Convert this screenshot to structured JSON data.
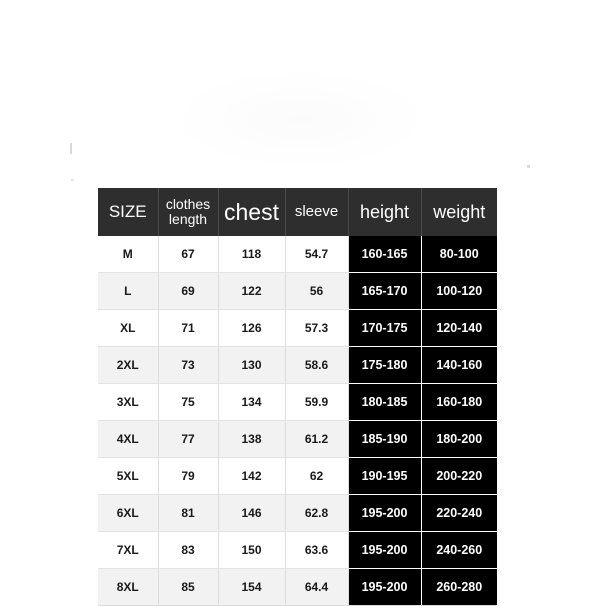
{
  "watermark": {
    "top_strip_text": "· · · · · · · · · ·"
  },
  "table": {
    "headers": [
      "SIZE",
      "clothes length",
      "chest",
      "sleeve",
      "height",
      "weight"
    ],
    "rows": [
      {
        "size": "M",
        "clothes_length": "67",
        "chest": "118",
        "sleeve": "54.7",
        "height": "160-165",
        "weight": "80-100"
      },
      {
        "size": "L",
        "clothes_length": "69",
        "chest": "122",
        "sleeve": "56",
        "height": "165-170",
        "weight": "100-120"
      },
      {
        "size": "XL",
        "clothes_length": "71",
        "chest": "126",
        "sleeve": "57.3",
        "height": "170-175",
        "weight": "120-140"
      },
      {
        "size": "2XL",
        "clothes_length": "73",
        "chest": "130",
        "sleeve": "58.6",
        "height": "175-180",
        "weight": "140-160"
      },
      {
        "size": "3XL",
        "clothes_length": "75",
        "chest": "134",
        "sleeve": "59.9",
        "height": "180-185",
        "weight": "160-180"
      },
      {
        "size": "4XL",
        "clothes_length": "77",
        "chest": "138",
        "sleeve": "61.2",
        "height": "185-190",
        "weight": "180-200"
      },
      {
        "size": "5XL",
        "clothes_length": "79",
        "chest": "142",
        "sleeve": "62",
        "height": "190-195",
        "weight": "200-220"
      },
      {
        "size": "6XL",
        "clothes_length": "81",
        "chest": "146",
        "sleeve": "62.8",
        "height": "195-200",
        "weight": "220-240"
      },
      {
        "size": "7XL",
        "clothes_length": "83",
        "chest": "150",
        "sleeve": "63.6",
        "height": "195-200",
        "weight": "240-260"
      },
      {
        "size": "8XL",
        "clothes_length": "85",
        "chest": "154",
        "sleeve": "64.4",
        "height": "195-200",
        "weight": "260-280"
      }
    ]
  },
  "colors": {
    "header_background": "#2e2e2e",
    "highlight_background": "#000000",
    "row_alt_background": "#f2f2f2",
    "page_background": "#ffffff",
    "text_dark": "#1a1a1a",
    "text_light": "#ffffff"
  }
}
